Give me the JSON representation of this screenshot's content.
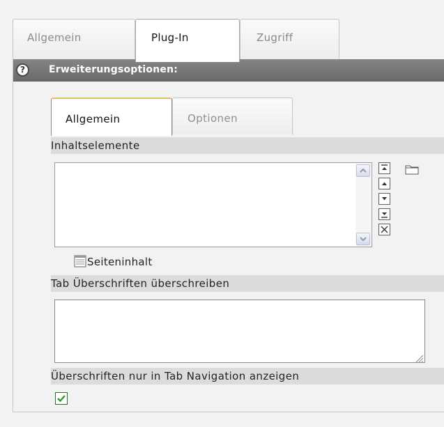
{
  "outer_tabs": [
    {
      "label": "Allgemein"
    },
    {
      "label": "Plug-In"
    },
    {
      "label": "Zugriff"
    }
  ],
  "panel": {
    "title": "Erweiterungsoptionen:",
    "help_icon": "?"
  },
  "inner_tabs": [
    {
      "label": "Allgemein"
    },
    {
      "label": "Optionen"
    }
  ],
  "fields": {
    "content_elements_label": "Inhaltselemente",
    "content_elements_items": [],
    "page_content_link": "Seiteninhalt",
    "tab_headings_label": "Tab Überschriften überschreiben",
    "tab_headings_value": "",
    "only_in_nav_label": "Überschriften nur in Tab Navigation anzeigen",
    "only_in_nav_checked": true
  },
  "icons": {
    "help": "help-icon",
    "folder": "folder-icon",
    "move_top": "move-top-icon",
    "move_up": "move-up-icon",
    "move_down": "move-down-icon",
    "move_bottom": "move-bottom-icon",
    "remove": "remove-icon",
    "page_content": "page-content-icon",
    "scroll_up": "scroll-up-icon",
    "scroll_down": "scroll-down-icon"
  },
  "colors": {
    "header_bg": "#777777",
    "active_tab_accent": "#e0c060",
    "checkbox_check": "#2e9a2e"
  }
}
